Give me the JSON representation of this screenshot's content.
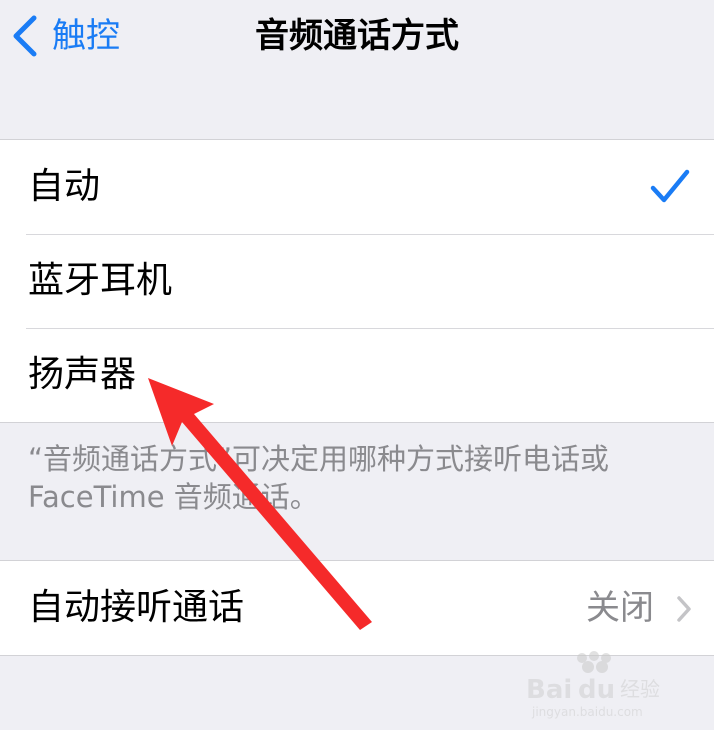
{
  "navbar": {
    "back_label": "触控",
    "title": "音频通话方式"
  },
  "options": [
    {
      "label": "自动",
      "selected": true
    },
    {
      "label": "蓝牙耳机",
      "selected": false
    },
    {
      "label": "扬声器",
      "selected": false
    }
  ],
  "footer_note": "“音频通话方式”可决定用哪种方式接听电话或FaceTime 音频通话。",
  "auto_answer": {
    "label": "自动接听通话",
    "value": "关闭"
  },
  "colors": {
    "accent": "#1a7cf5",
    "annotation": "#f52a2a",
    "background": "#efeff4"
  },
  "watermark": {
    "brand": "Baidu经验",
    "url": "jingyan.baidu.com"
  }
}
